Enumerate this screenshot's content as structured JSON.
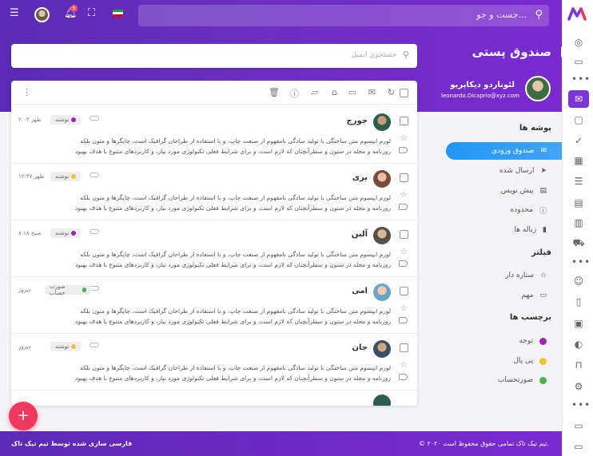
{
  "topbar": {
    "search_placeholder": "جست و جو...",
    "notification_count": "5"
  },
  "header": {
    "title": "صندوق پستی",
    "search_placeholder": "جستجوی ایمیل"
  },
  "user": {
    "name": "لئوناردو دیکاپریو",
    "email": "leonardo.Dicaprio@xyz.com"
  },
  "sidebar": {
    "folders_title": "پوشه ها",
    "folders": [
      {
        "label": "صندوق ورودی",
        "icon": "mail-icon"
      },
      {
        "label": "ارسال شده",
        "icon": "send-icon"
      },
      {
        "label": "پیش نویس",
        "icon": "draft-icon"
      },
      {
        "label": "محدوده",
        "icon": "info-icon"
      },
      {
        "label": "زباله ها",
        "icon": "trash-icon"
      }
    ],
    "filter_title": "فیلتر",
    "filters": [
      {
        "label": "ستاره دار",
        "icon": "star-icon"
      },
      {
        "label": "مهم",
        "icon": "label-icon"
      }
    ],
    "labels_title": "برچسب ها",
    "labels": [
      {
        "label": "توجه",
        "color": "#9c27b0"
      },
      {
        "label": "پی پال",
        "color": "#fbc02d"
      },
      {
        "label": "صورتحساب",
        "color": "#4caf50"
      }
    ]
  },
  "emails": [
    {
      "name": "جورج",
      "time": "۲:۰۳ ظهر",
      "tag": "نوشته",
      "tag_color": "#9c27b0",
      "line1": "لورم ایپسوم متن ساختگی با تولید سادگی نامفهوم از صنعت چاپ، و با استفاده از طراحان گرافیک است، چاپگرها و متون بلکه",
      "line2": "روزنامه و مجله در ستون و سطرآنچنان که لازم است، و برای شرایط فعلی تکنولوژی مورد نیاز، و کاربردهای متنوع با هدف بهبود"
    },
    {
      "name": "پری",
      "time": "۱۲:۴۷ ظهر",
      "tag": "نوشته",
      "tag_color": "#fbc02d",
      "line1": "لورم ایپسوم متن ساختگی با تولید سادگی نامفهوم از صنعت چاپ، و با استفاده از طراحان گرافیک است، چاپگرها و متون بلکه",
      "line2": "روزنامه و مجله در ستون و سطرآنچنان که لازم است، و برای شرایط فعلی تکنولوژی مورد نیاز، و کاربردهای متنوع با هدف بهبود"
    },
    {
      "name": "آلین",
      "time": "۸:۱۸ صبح",
      "tag": "نوشته",
      "tag_color": "#9c27b0",
      "line1": "لورم ایپسوم متن ساختگی با تولید سادگی نامفهوم از صنعت چاپ، و با استفاده از طراحان گرافیک است، چاپگرها و متون بلکه",
      "line2": "روزنامه و مجله در ستون و سطرآنچنان که لازم است، و برای شرایط فعلی تکنولوژی مورد نیاز، و کاربردهای متنوع با هدف بهبود"
    },
    {
      "name": "امی",
      "time": "دیروز",
      "tag": "صورت حساب",
      "tag_color": "#4caf50",
      "line1": "لورم ایپسوم متن ساختگی با تولید سادگی نامفهوم از صنعت چاپ، و با استفاده از طراحان گرافیک است، چاپگرها و متون بلکه",
      "line2": "روزنامه و مجله در ستون و سطرآنچنان که لازم است، و برای شرایط فعلی تکنولوژی مورد نیاز، و کاربردهای متنوع با هدف بهبود"
    },
    {
      "name": "جان",
      "time": "دیروز",
      "tag": "نوشته",
      "tag_color": "#fbc02d",
      "line1": "لورم ایپسوم متن ساختگی با تولید سادگی نامفهوم از صنعت چاپ، و با استفاده از طراحان گرافیک است، چاپگرها و متون بلکه",
      "line2": "روزنامه و مجله در ستون و سطرآنچنان که لازم است، و برای شرایط فعلی تکنولوژی مورد نیاز، و کاربردهای متنوع با هدف بهبود"
    }
  ],
  "footer": {
    "left": "فارسی سازی شده توسط تیم تیک تاک",
    "right": "© ۲۰۲۰ تیم تیک تاک تمامی حقوق محفوظ است."
  },
  "fab_label": "+"
}
